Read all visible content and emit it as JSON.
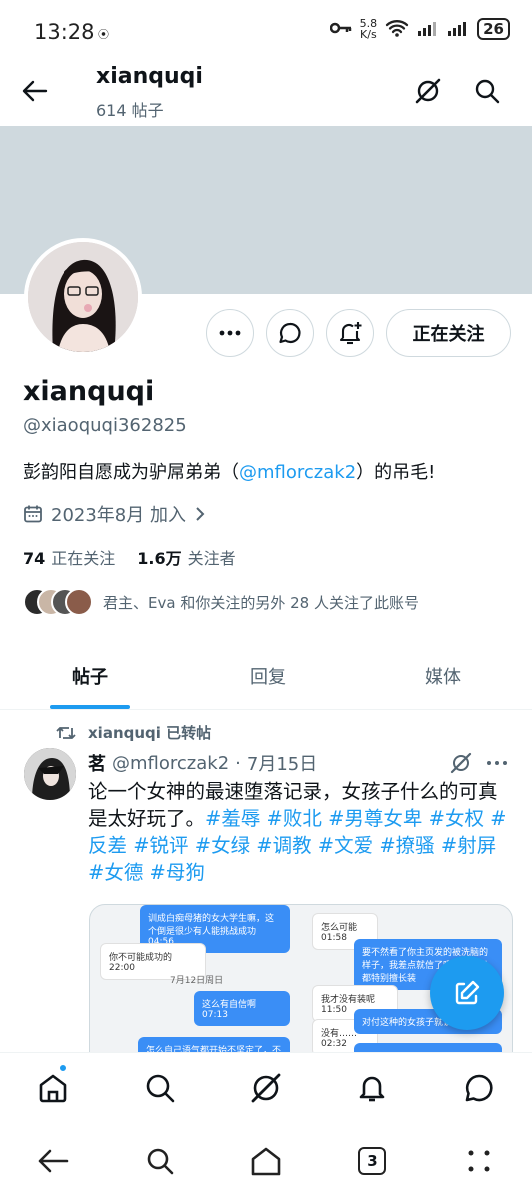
{
  "status_bar": {
    "time": "13:28",
    "net_speed_value": "5.8",
    "net_speed_unit": "K/s",
    "battery": "26"
  },
  "header": {
    "title": "xianquqi",
    "subtitle": "614 帖子"
  },
  "profile": {
    "display_name": "xianquqi",
    "handle": "@xiaoquqi362825",
    "bio_prefix": "彭韵阳自愿成为驴屌弟弟（",
    "bio_link": "@mflorczak2",
    "bio_suffix": "）的吊毛!",
    "joined": "2023年8月 加入",
    "following_count": "74",
    "following_label": "正在关注",
    "followers_count": "1.6万",
    "followers_label": "关注者",
    "followed_by_text": "君主、Eva 和你关注的另外 28 人关注了此账号",
    "follow_button_label": "正在关注"
  },
  "tabs": [
    {
      "label": "帖子",
      "active": true
    },
    {
      "label": "回复",
      "active": false
    },
    {
      "label": "媒体",
      "active": false
    }
  ],
  "post": {
    "retweet_label": "xianquqi 已转帖",
    "author_name": "茗",
    "author_handle": "@mflorczak2",
    "separator": "·",
    "date": "7月15日",
    "text": "论一个女神的最速堕落记录，女孩子什么的可真是太好玩了。",
    "hashtags": "#羞辱 #败北 #男尊女卑 #女权 #反差 #锐评 #女绿 #调教 #文爱 #撩骚 #射屏 #女德 #母狗",
    "media_chat": {
      "b1": "训成白痴母猪的女大学生嘛，这个倒是很少有人能挑战成功",
      "b1_time": "04:56",
      "b2": "怎么可能",
      "b2_time": "01:58",
      "b3": "要不然看了你主页发的被洗脑的样子，我差点就信了呢，女孩子都特别擅长装",
      "b4": "你不可能成功的",
      "b4_time": "22:00",
      "date_sep": "7月12日周日",
      "b5": "这么有自信啊",
      "b5_time": "07:13",
      "b6": "我才没有装呢",
      "b6_time": "11:50",
      "b7": "没有……",
      "b7_time": "02:32",
      "b8": "对付这种的女孩子就该",
      "b9": "怎么自己语气都开始不坚定了，不"
    }
  },
  "colors": {
    "accent": "#1d9bf0",
    "banner": "#cfd9de",
    "text_secondary": "#536471"
  },
  "icons": {
    "back": "arrow-left-icon",
    "grok": "grok-icon",
    "search": "search-icon",
    "more": "more-icon",
    "message": "message-icon",
    "notify_add": "bell-plus-icon",
    "calendar": "calendar-icon",
    "chevron": "chevron-right-icon",
    "retweet": "retweet-icon",
    "compose": "compose-icon",
    "home": "home-icon",
    "bell": "bell-icon",
    "mail": "message-icon"
  },
  "system_nav": {
    "tabs_count": "3"
  }
}
